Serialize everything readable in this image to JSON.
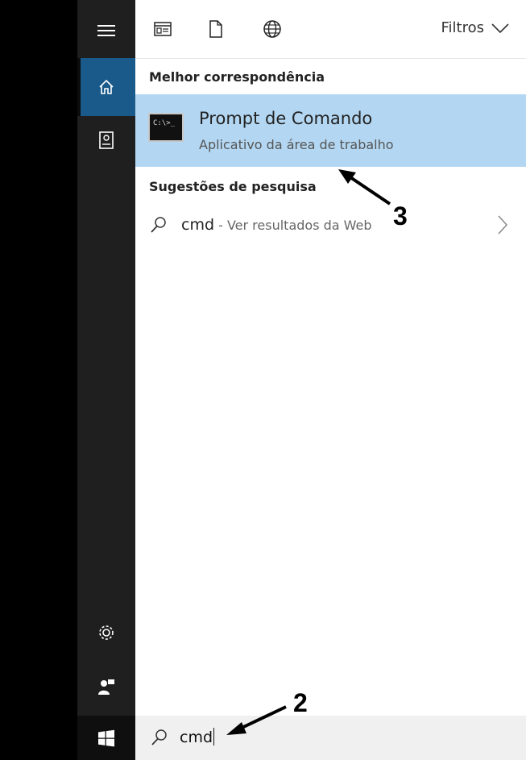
{
  "nav": {
    "items": [
      {
        "icon": "hamburger-menu-icon"
      },
      {
        "icon": "home-icon",
        "active": true
      },
      {
        "icon": "notebook-icon"
      },
      {
        "icon": "gear-icon"
      },
      {
        "icon": "feedback-icon"
      }
    ]
  },
  "toolbar": {
    "filters_label": "Filtros",
    "icons": [
      "apps-filter-icon",
      "documents-filter-icon",
      "web-filter-icon"
    ]
  },
  "best_match": {
    "heading": "Melhor correspondência",
    "title": "Prompt de Comando",
    "subtitle": "Aplicativo da área de trabalho",
    "icon_text": "C:\\>_"
  },
  "suggestions": {
    "heading": "Sugestões de pesquisa",
    "items": [
      {
        "query": "cmd",
        "detail": " - Ver resultados da Web"
      }
    ]
  },
  "search": {
    "value": "cmd"
  },
  "annotations": {
    "step2": "2",
    "step3": "3"
  },
  "colors": {
    "nav_bg": "#1f1f1f",
    "active_nav": "#1a5a8a",
    "best_match_bg": "#b3d7f2"
  }
}
